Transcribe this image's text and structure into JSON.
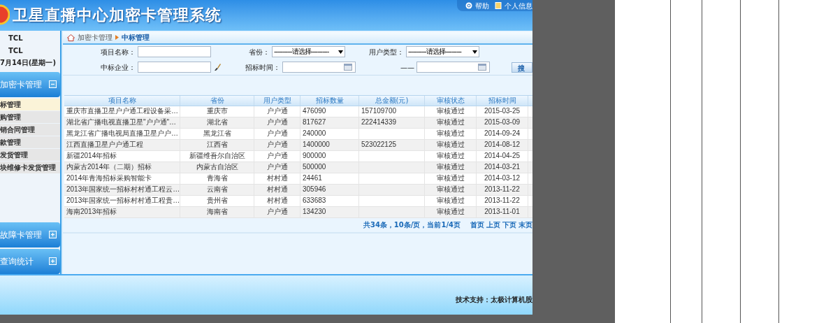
{
  "header": {
    "title": "卫星直播中心加密卡管理系统",
    "links": [
      {
        "label": "帮助",
        "kind": "help"
      },
      {
        "label": "个人信息",
        "kind": "user"
      }
    ]
  },
  "sidebar": {
    "info": [
      "TCL",
      "TCL",
      "7月14日(星期一)"
    ],
    "sections": [
      {
        "title": "加密卡管理",
        "expanded": true,
        "items": [
          {
            "label": "标管理",
            "selected": true
          },
          {
            "label": "购管理",
            "selected": false
          },
          {
            "label": "销合同管理",
            "selected": false
          },
          {
            "label": "款管理",
            "selected": false
          },
          {
            "label": "发货管理",
            "selected": false
          },
          {
            "label": "块维修卡发货管理",
            "selected": false
          }
        ]
      },
      {
        "title": "故障卡管理",
        "expanded": false
      },
      {
        "title": "查询统计",
        "expanded": false
      }
    ]
  },
  "breadcrumb": [
    "加密卡管理",
    "中标管理"
  ],
  "filters": [
    [
      {
        "label": "项目名称：",
        "kind": "text"
      },
      {
        "label": "省份：",
        "kind": "select",
        "value": "-----------请选择-----------"
      },
      {
        "label": "用户类型：",
        "kind": "select",
        "value": "-----------请选择----------"
      }
    ],
    [
      {
        "label": "中标企业：",
        "kind": "picker"
      },
      {
        "label": "招标时间：",
        "kind": "date"
      },
      {
        "label": "——",
        "kind": "date"
      }
    ]
  ],
  "search_button": "搜",
  "table": {
    "columns": [
      "项目名称",
      "省份",
      "用户类型",
      "招标数量",
      "总金额(元)",
      "审核状态",
      "招标时间"
    ],
    "rows": [
      [
        "重庆市直播卫星户户通工程设备采…",
        "重庆市",
        "户户通",
        "476090",
        "157109700",
        "审核通过",
        "2015-03-25"
      ],
      [
        "湖北省广播电视直播卫星\"户户通\"…",
        "湖北省",
        "户户通",
        "817627",
        "222414339",
        "审核通过",
        "2015-03-09"
      ],
      [
        "黑龙江省广播电视局直播卫星户户…",
        "黑龙江省",
        "户户通",
        "240000",
        "",
        "审核通过",
        "2014-09-24"
      ],
      [
        "江西直播卫星户户通工程",
        "江西省",
        "户户通",
        "1400000",
        "523022125",
        "审核通过",
        "2014-08-12"
      ],
      [
        "新疆2014年招标",
        "新疆维吾尔自治区",
        "户户通",
        "900000",
        "",
        "审核通过",
        "2014-04-25"
      ],
      [
        "内蒙古2014年（二期）招标",
        "内蒙古自治区",
        "户户通",
        "500000",
        "",
        "审核通过",
        "2014-03-21"
      ],
      [
        "2014年青海招标采购智能卡",
        "青海省",
        "村村通",
        "24461",
        "",
        "审核通过",
        "2014-03-12"
      ],
      [
        "2013年国家统一招标村村通工程云…",
        "云南省",
        "村村通",
        "305946",
        "",
        "审核通过",
        "2013-11-22"
      ],
      [
        "2013年国家统一招标村村通工程贵…",
        "贵州省",
        "村村通",
        "633683",
        "",
        "审核通过",
        "2013-11-22"
      ],
      [
        "海南2013年招标",
        "海南省",
        "户户通",
        "134230",
        "",
        "审核通过",
        "2013-11-01"
      ]
    ]
  },
  "pagination": {
    "summary": "共34条，10条/页，当前1/4页",
    "links": [
      "首页",
      "上页",
      "下页",
      "末页"
    ]
  },
  "footer": "技术支持：太极计算机股"
}
